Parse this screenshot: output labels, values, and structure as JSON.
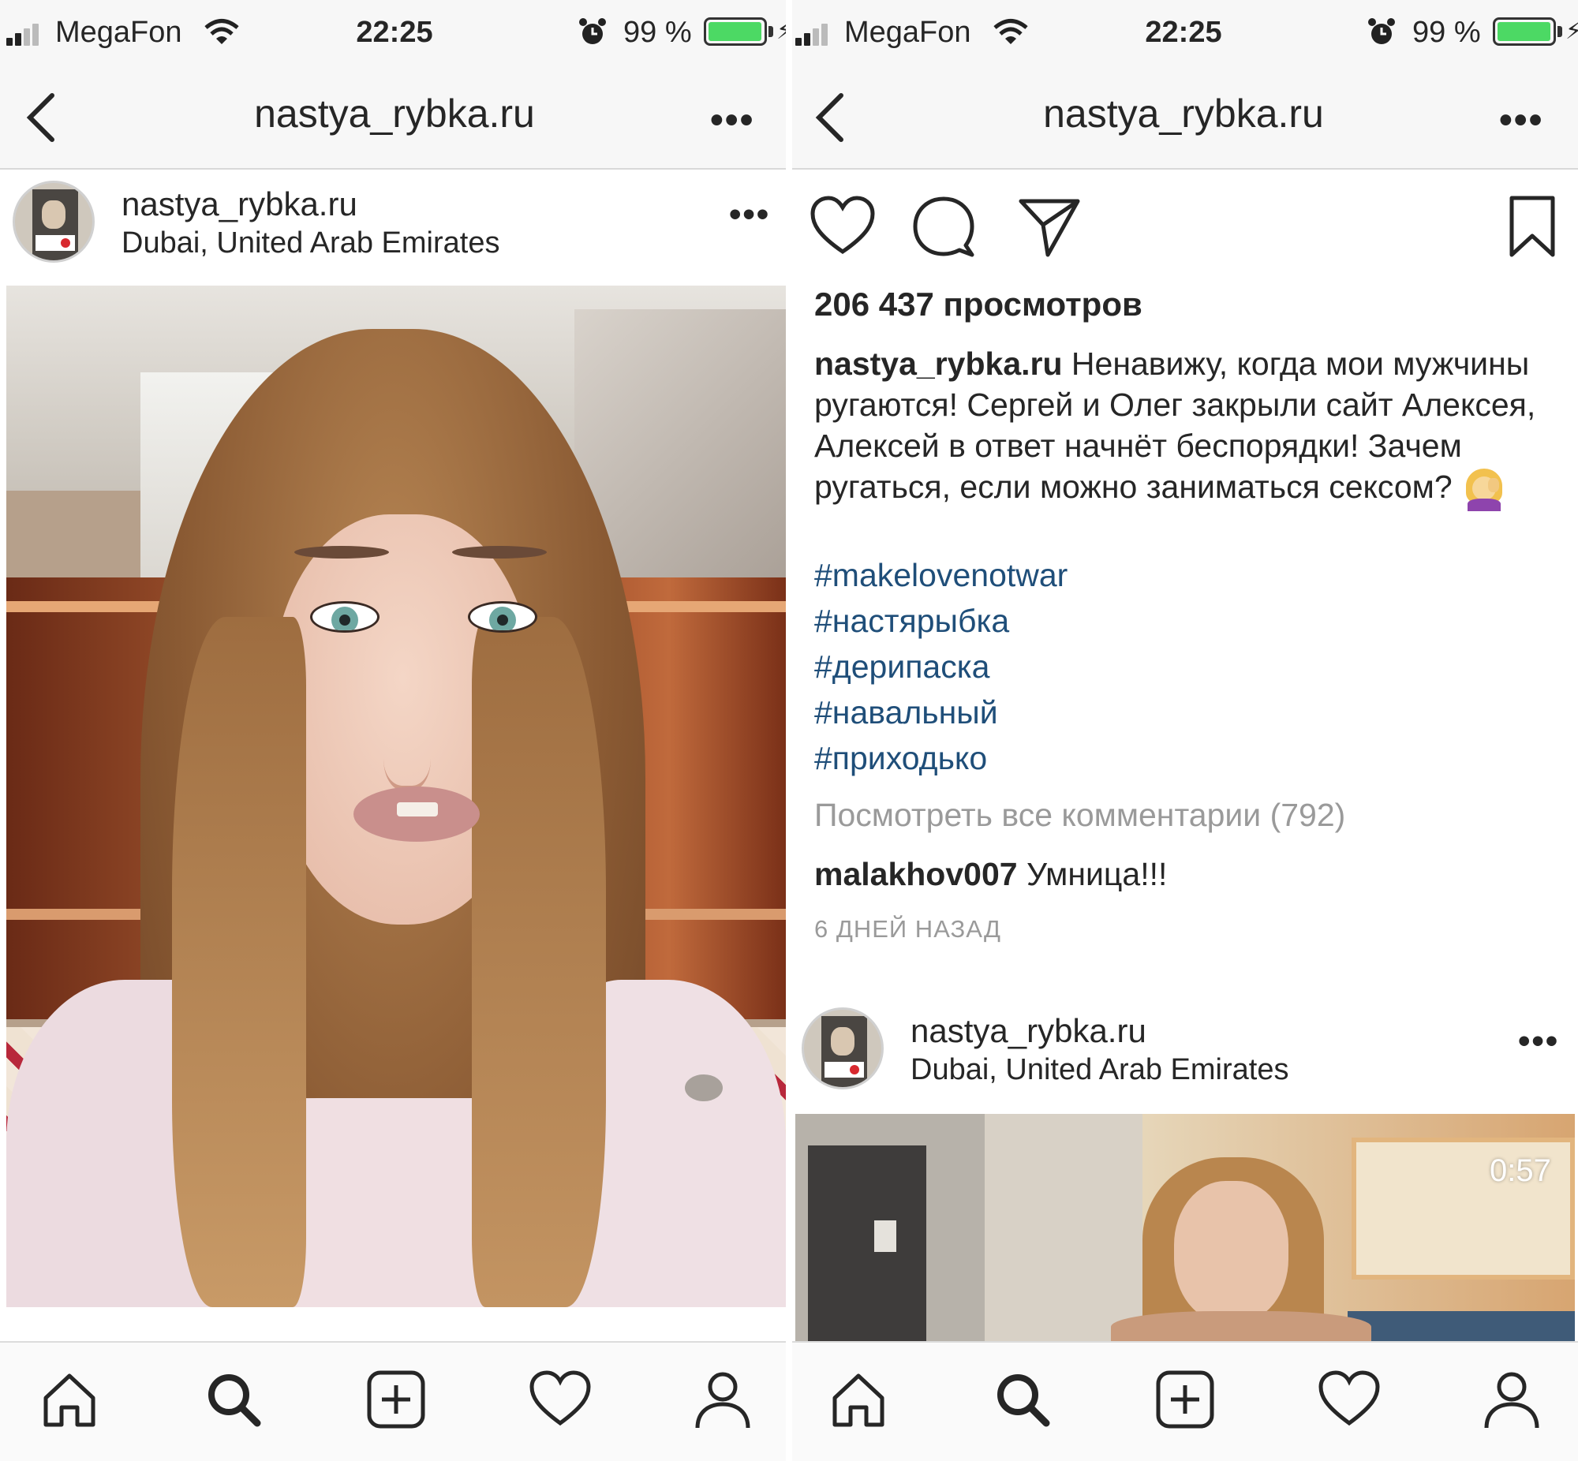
{
  "status_bar": {
    "carrier": "MegaFon",
    "time": "22:25",
    "battery_percent": "99 %",
    "battery_level": 0.99
  },
  "nav": {
    "title": "nastya_rybka.ru",
    "more": "•••"
  },
  "post_left": {
    "username": "nastya_rybka.ru",
    "location": "Dubai, United Arab Emirates",
    "more": "•••"
  },
  "post_right": {
    "views": "206 437 просмотров",
    "caption_user": "nastya_rybka.ru",
    "caption_text": "Ненавижу, когда мои мужчины ругаются! Сергей и Олег закрыли сайт Алексея, Алексей в ответ начнёт беспорядки! Зачем ругаться, если можно заниматься сексом?",
    "hashtags": [
      "#makelovenotwar",
      "#настярыбка",
      "#дерипаска",
      "#навальный",
      "#приходько"
    ],
    "view_all_comments": "Посмотреть все комментарии (792)",
    "comment_user": "malakhov007",
    "comment_text": "Умница!!!",
    "time_ago": "6 ДНЕЙ НАЗАД"
  },
  "post_right_next": {
    "username": "nastya_rybka.ru",
    "location": "Dubai, United Arab Emirates",
    "more": "•••",
    "video_duration": "0:57"
  },
  "icons": {
    "tabbar": [
      "home-icon",
      "search-icon",
      "add-post-icon",
      "activity-heart-icon",
      "profile-icon"
    ],
    "actions": [
      "like-heart-icon",
      "comment-icon",
      "share-icon",
      "bookmark-icon"
    ]
  },
  "colors": {
    "hashtag": "#1f4e79",
    "muted": "#9a9a9a",
    "battery": "#4cd964"
  }
}
